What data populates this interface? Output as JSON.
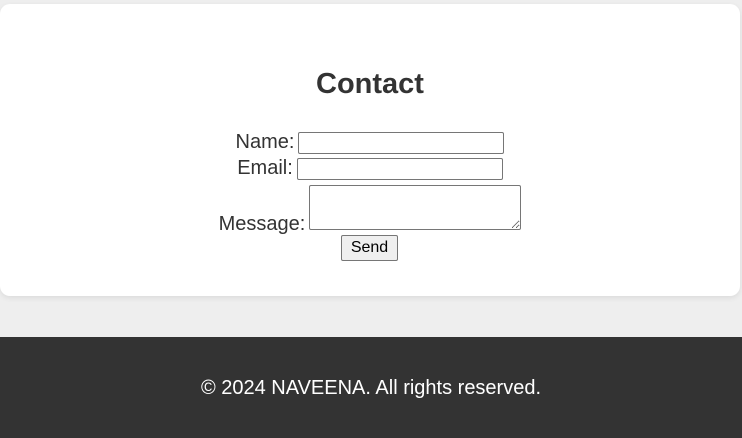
{
  "contact": {
    "title": "Contact",
    "name_label": "Name:",
    "name_value": "",
    "email_label": "Email:",
    "email_value": "",
    "message_label": "Message:",
    "message_value": "",
    "send_label": "Send"
  },
  "footer": {
    "text": "© 2024 NAVEENA. All rights reserved."
  },
  "colors": {
    "page_background": "#eeeeee",
    "card_background": "#ffffff",
    "footer_background": "#333333",
    "text": "#333333"
  }
}
